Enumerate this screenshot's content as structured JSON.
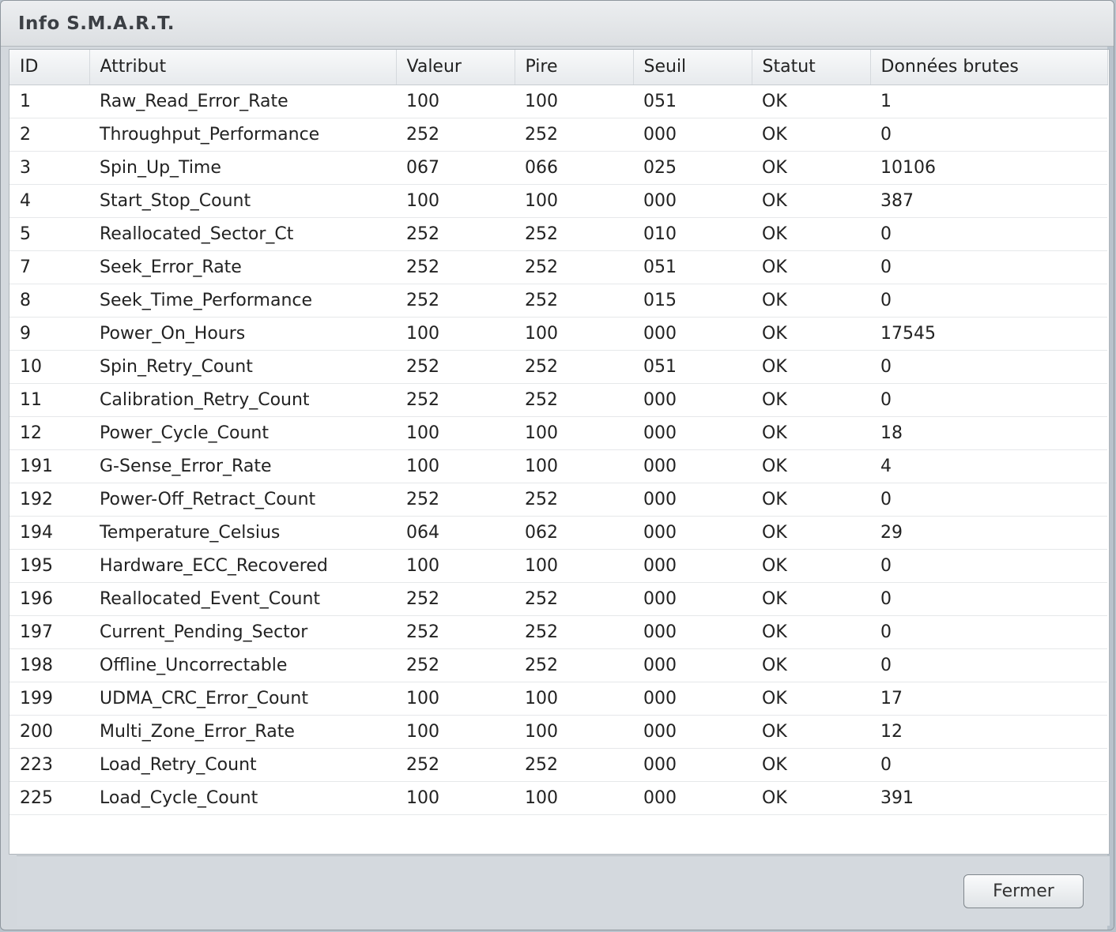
{
  "window": {
    "title": "Info S.M.A.R.T."
  },
  "table": {
    "columns": [
      "ID",
      "Attribut",
      "Valeur",
      "Pire",
      "Seuil",
      "Statut",
      "Données brutes"
    ],
    "rows": [
      [
        "1",
        "Raw_Read_Error_Rate",
        "100",
        "100",
        "051",
        "OK",
        "1"
      ],
      [
        "2",
        "Throughput_Performance",
        "252",
        "252",
        "000",
        "OK",
        "0"
      ],
      [
        "3",
        "Spin_Up_Time",
        "067",
        "066",
        "025",
        "OK",
        "10106"
      ],
      [
        "4",
        "Start_Stop_Count",
        "100",
        "100",
        "000",
        "OK",
        "387"
      ],
      [
        "5",
        "Reallocated_Sector_Ct",
        "252",
        "252",
        "010",
        "OK",
        "0"
      ],
      [
        "7",
        "Seek_Error_Rate",
        "252",
        "252",
        "051",
        "OK",
        "0"
      ],
      [
        "8",
        "Seek_Time_Performance",
        "252",
        "252",
        "015",
        "OK",
        "0"
      ],
      [
        "9",
        "Power_On_Hours",
        "100",
        "100",
        "000",
        "OK",
        "17545"
      ],
      [
        "10",
        "Spin_Retry_Count",
        "252",
        "252",
        "051",
        "OK",
        "0"
      ],
      [
        "11",
        "Calibration_Retry_Count",
        "252",
        "252",
        "000",
        "OK",
        "0"
      ],
      [
        "12",
        "Power_Cycle_Count",
        "100",
        "100",
        "000",
        "OK",
        "18"
      ],
      [
        "191",
        "G-Sense_Error_Rate",
        "100",
        "100",
        "000",
        "OK",
        "4"
      ],
      [
        "192",
        "Power-Off_Retract_Count",
        "252",
        "252",
        "000",
        "OK",
        "0"
      ],
      [
        "194",
        "Temperature_Celsius",
        "064",
        "062",
        "000",
        "OK",
        "29"
      ],
      [
        "195",
        "Hardware_ECC_Recovered",
        "100",
        "100",
        "000",
        "OK",
        "0"
      ],
      [
        "196",
        "Reallocated_Event_Count",
        "252",
        "252",
        "000",
        "OK",
        "0"
      ],
      [
        "197",
        "Current_Pending_Sector",
        "252",
        "252",
        "000",
        "OK",
        "0"
      ],
      [
        "198",
        "Offline_Uncorrectable",
        "252",
        "252",
        "000",
        "OK",
        "0"
      ],
      [
        "199",
        "UDMA_CRC_Error_Count",
        "100",
        "100",
        "000",
        "OK",
        "17"
      ],
      [
        "200",
        "Multi_Zone_Error_Rate",
        "100",
        "100",
        "000",
        "OK",
        "12"
      ],
      [
        "223",
        "Load_Retry_Count",
        "252",
        "252",
        "000",
        "OK",
        "0"
      ],
      [
        "225",
        "Load_Cycle_Count",
        "100",
        "100",
        "000",
        "OK",
        "391"
      ]
    ]
  },
  "footer": {
    "close_label": "Fermer"
  }
}
